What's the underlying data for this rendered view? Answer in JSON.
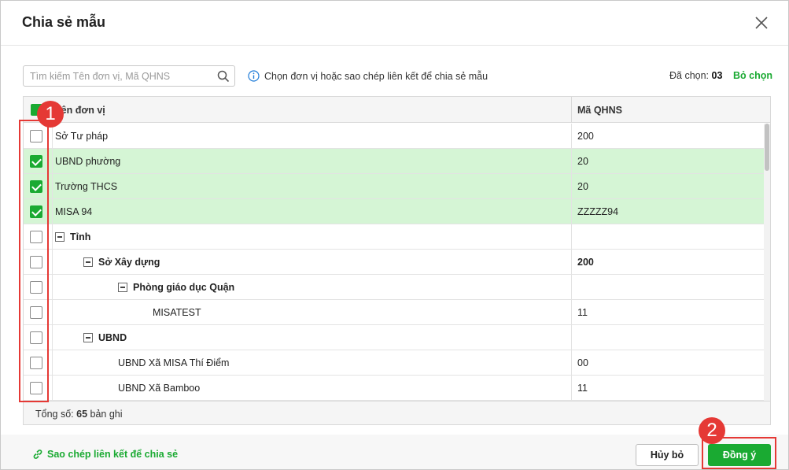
{
  "dialog": {
    "title": "Chia sẻ mẫu",
    "search_placeholder": "Tìm kiếm Tên đơn vị, Mã QHNS",
    "info_text": "Chọn đơn vị hoặc sao chép liên kết để chia sẻ mẫu",
    "selected_label": "Đã chọn:",
    "selected_count": "03",
    "clear_selection": "Bỏ chọn"
  },
  "grid": {
    "col_name": "Tên đơn vị",
    "col_code": "Mã QHNS",
    "rows": [
      {
        "name": "Sở Tư pháp",
        "code": "200"
      },
      {
        "name": "UBND phường",
        "code": "20"
      },
      {
        "name": "Trường THCS",
        "code": "20"
      },
      {
        "name": "MISA 94",
        "code": "ZZZZZ94"
      },
      {
        "name": "Tỉnh",
        "code": ""
      },
      {
        "name": "Sở Xây dựng",
        "code": "200"
      },
      {
        "name": "Phòng giáo dục Quận",
        "code": ""
      },
      {
        "name": "MISATEST",
        "code": "11"
      },
      {
        "name": "UBND",
        "code": ""
      },
      {
        "name": "UBND Xã MISA Thí Điểm",
        "code": "00"
      },
      {
        "name": "UBND Xã Bamboo",
        "code": "11"
      }
    ],
    "total_label": "Tổng số:",
    "total_count": "65",
    "total_suffix": "bản ghi"
  },
  "footer": {
    "copy_link": "Sao chép liên kết để chia sẻ",
    "cancel": "Hủy bỏ",
    "ok": "Đồng ý"
  },
  "annotations": {
    "badge1": "1",
    "badge2": "2"
  },
  "colors": {
    "accent": "#1aaa32",
    "selected_row": "#d5f5d5",
    "annotation": "#e53935"
  }
}
